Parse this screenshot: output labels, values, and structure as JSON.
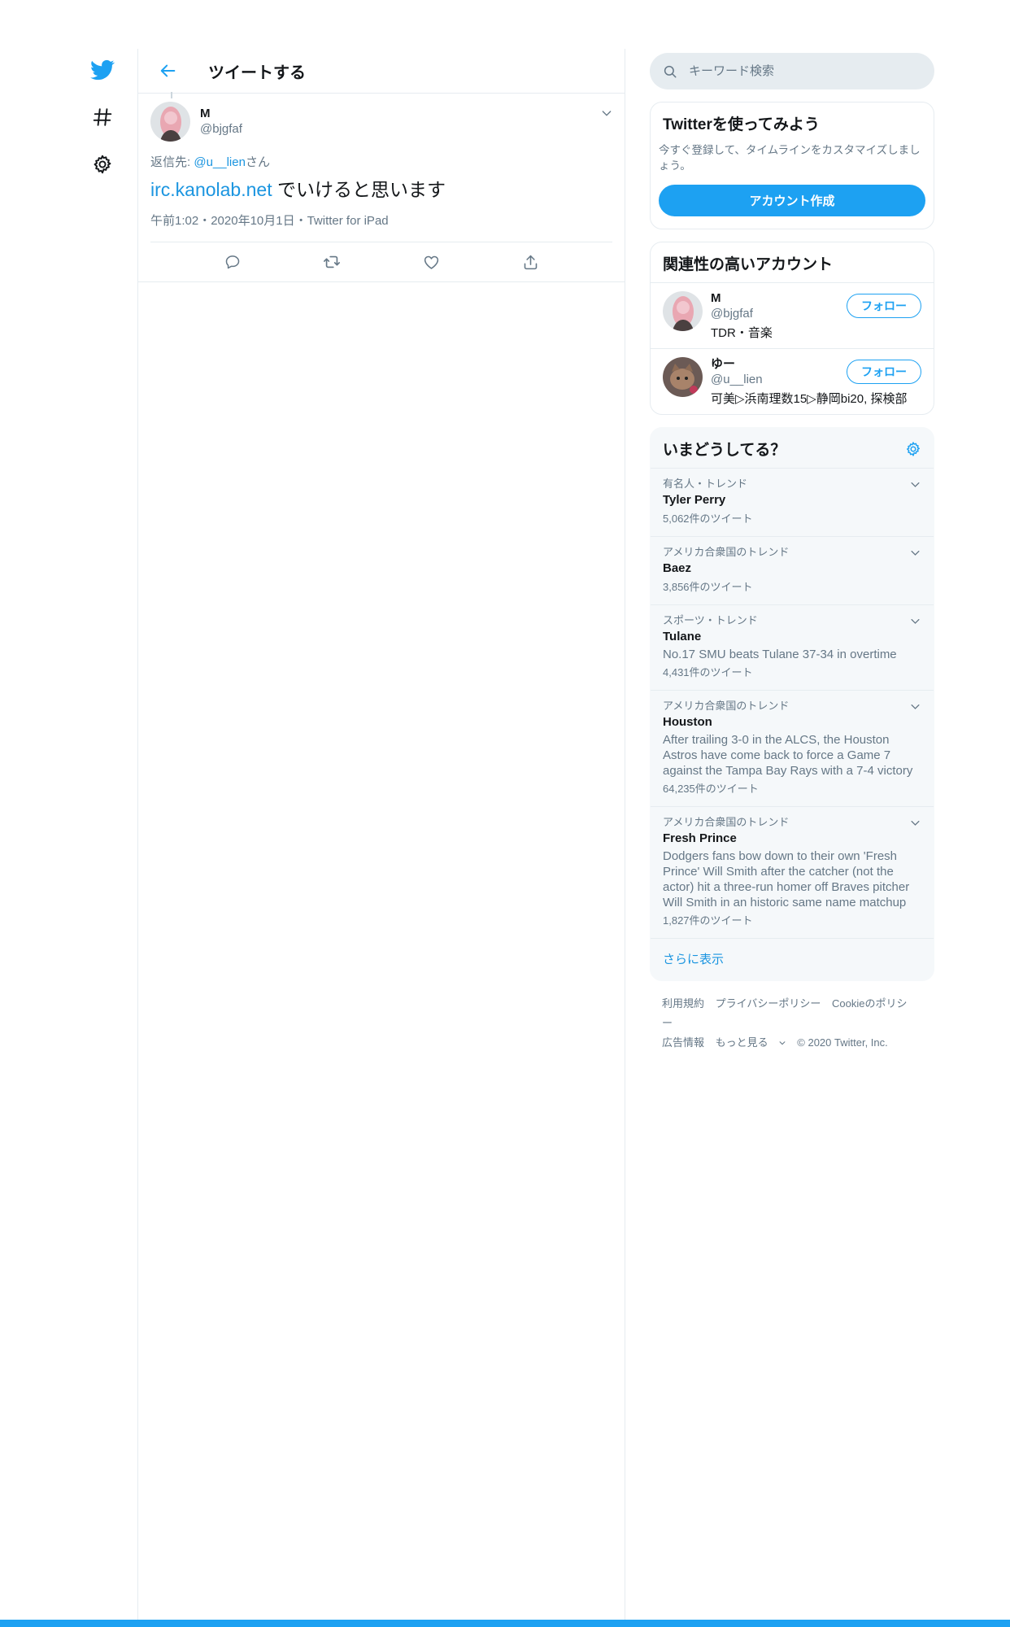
{
  "nav": {
    "items": [
      {
        "icon": "twitter-bird-icon"
      },
      {
        "icon": "hashtag-icon"
      },
      {
        "icon": "gear-icon"
      }
    ]
  },
  "header": {
    "title": "ツイートする"
  },
  "tweet": {
    "author_name": "M",
    "author_handle": "@bjgfaf",
    "reply_prefix": "返信先: ",
    "reply_mention": "@u__lien",
    "reply_suffix": "さん",
    "link": "irc.kanolab.net",
    "text": " でいけると思います",
    "meta": "午前1:02・2020年10月1日・Twitter for iPad"
  },
  "search": {
    "placeholder": "キーワード検索"
  },
  "signup": {
    "title": "Twitterを使ってみよう",
    "desc": "今すぐ登録して、タイムラインをカスタマイズしましょう。",
    "button": "アカウント作成"
  },
  "related": {
    "title": "関連性の高いアカウント",
    "users": [
      {
        "name": "M",
        "handle": "@bjgfaf",
        "bio": "TDR・音楽",
        "follow": "フォロー"
      },
      {
        "name": "ゆー",
        "handle": "@u__lien",
        "bio": "可美▷浜南理数15▷静岡bi20, 探検部",
        "follow": "フォロー"
      }
    ]
  },
  "trends": {
    "title": "いまどうしてる？",
    "items": [
      {
        "category": "有名人・トレンド",
        "name": "Tyler Perry",
        "desc": "",
        "count": "5,062件のツイート"
      },
      {
        "category": "アメリカ合衆国のトレンド",
        "name": "Baez",
        "desc": "",
        "count": "3,856件のツイート"
      },
      {
        "category": "スポーツ・トレンド",
        "name": "Tulane",
        "desc": "No.17 SMU beats Tulane 37-34 in overtime",
        "count": "4,431件のツイート"
      },
      {
        "category": "アメリカ合衆国のトレンド",
        "name": "Houston",
        "desc": "After trailing 3-0 in the ALCS, the Houston Astros have come back to force a Game 7 against the Tampa Bay Rays with a 7-4 victory",
        "count": "64,235件のツイート"
      },
      {
        "category": "アメリカ合衆国のトレンド",
        "name": "Fresh Prince",
        "desc": "Dodgers fans bow down to their own 'Fresh Prince' Will Smith after the catcher (not the actor) hit a three-run homer off Braves pitcher Will Smith in an historic same name matchup",
        "count": "1,827件のツイート"
      }
    ],
    "show_more": "さらに表示"
  },
  "footer": {
    "terms": "利用規約",
    "privacy": "プライバシーポリシー",
    "cookie": "Cookieのポリシー",
    "ads": "広告情報",
    "more": "もっと見る",
    "copyright": "© 2020 Twitter, Inc."
  },
  "colors": {
    "accent": "#1da1f2",
    "link": "#1b95e0",
    "muted": "#657786",
    "border": "#e6ecf0"
  }
}
